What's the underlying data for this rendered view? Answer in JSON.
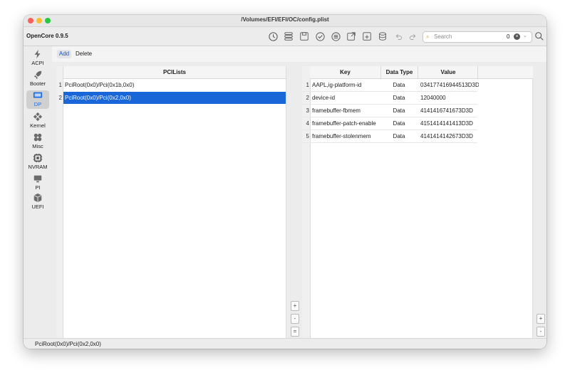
{
  "window": {
    "title": "/Volumes/EFI/EFI/OC/config.plist",
    "app_name": "OpenCore 0.9.5"
  },
  "toolbar": {
    "search_placeholder": "Search",
    "search_count": "0"
  },
  "sidebar": {
    "items": [
      {
        "label": "ACPI",
        "icon": "lightning-icon"
      },
      {
        "label": "Booter",
        "icon": "rocket-icon"
      },
      {
        "label": "DP",
        "icon": "display-icon",
        "active": true
      },
      {
        "label": "Kernel",
        "icon": "kernel-icon"
      },
      {
        "label": "Misc",
        "icon": "misc-icon"
      },
      {
        "label": "NVRAM",
        "icon": "chip-icon"
      },
      {
        "label": "PI",
        "icon": "monitor-icon"
      },
      {
        "label": "UEFI",
        "icon": "cube-icon"
      }
    ]
  },
  "actions": {
    "add": "Add",
    "delete": "Delete"
  },
  "pcilists": {
    "header": "PCILists",
    "rows": [
      {
        "num": "1",
        "value": "PciRoot(0x0)/Pci(0x1b,0x0)"
      },
      {
        "num": "2",
        "value": "PciRoot(0x0)/Pci(0x2,0x0)"
      }
    ]
  },
  "properties": {
    "headers": {
      "key": "Key",
      "type": "Data Type",
      "value": "Value"
    },
    "rows": [
      {
        "num": "1",
        "key": "AAPL,ig-platform-id",
        "type": "Data",
        "value": "034177416944513D3D"
      },
      {
        "num": "2",
        "key": "device-id",
        "type": "Data",
        "value": "12040000"
      },
      {
        "num": "3",
        "key": "framebuffer-fbmem",
        "type": "Data",
        "value": "4141416741673D3D"
      },
      {
        "num": "4",
        "key": "framebuffer-patch-enable",
        "type": "Data",
        "value": "4151414141413D3D"
      },
      {
        "num": "5",
        "key": "framebuffer-stolenmem",
        "type": "Data",
        "value": "4141414142673D3D"
      }
    ]
  },
  "side_buttons": {
    "plus": "+",
    "minus": "-",
    "equals": "="
  },
  "status": {
    "text": "PciRoot(0x0)/Pci(0x2,0x0)"
  },
  "colors": {
    "accent": "#1966d8",
    "window_bg": "#ececec"
  }
}
